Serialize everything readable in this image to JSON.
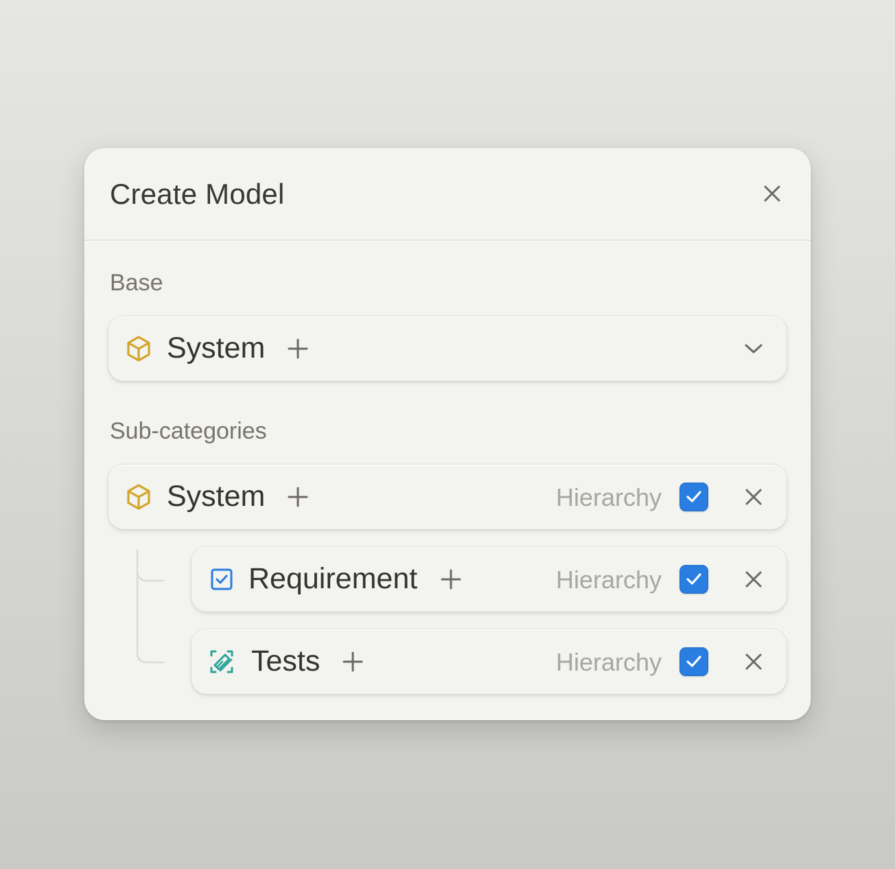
{
  "dialog": {
    "title": "Create Model",
    "close_icon": "close-icon"
  },
  "base": {
    "section_label": "Base",
    "selected": {
      "name": "System",
      "icon": "cube-icon",
      "icon_color": "#d4a52a",
      "add_icon": "plus-icon",
      "dropdown_icon": "chevron-down-icon"
    }
  },
  "subcategories": {
    "section_label": "Sub-categories",
    "items": [
      {
        "name": "System",
        "icon": "cube-icon",
        "icon_color": "#d4a52a",
        "hierarchy_label": "Hierarchy",
        "hierarchy_checked": true,
        "level": 0
      },
      {
        "name": "Requirement",
        "icon": "checkbox-square-icon",
        "icon_color": "#2a7de1",
        "hierarchy_label": "Hierarchy",
        "hierarchy_checked": true,
        "level": 1
      },
      {
        "name": "Tests",
        "icon": "test-flask-icon",
        "icon_color": "#2aa59a",
        "hierarchy_label": "Hierarchy",
        "hierarchy_checked": true,
        "level": 1
      }
    ]
  },
  "colors": {
    "checkbox_accent": "#2a7de1",
    "dialog_background": "#f3f3ef"
  }
}
